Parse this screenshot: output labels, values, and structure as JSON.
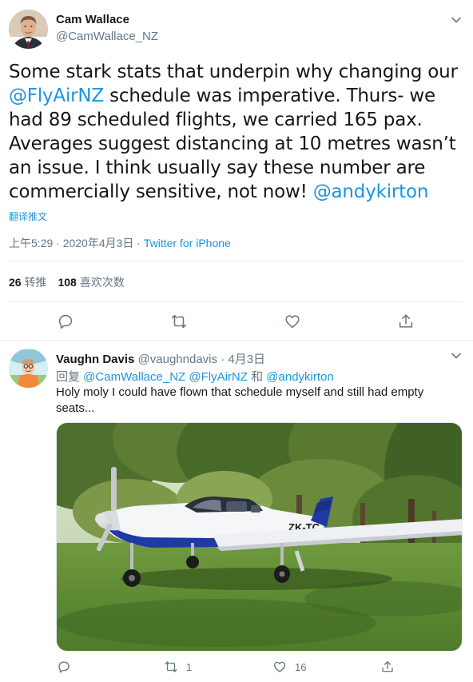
{
  "main_tweet": {
    "author_name": "Cam Wallace",
    "author_handle": "@CamWallace_NZ",
    "text_parts": [
      "Some stark stats that underpin why changing our ",
      "@FlyAirNZ",
      " schedule was imperative. Thurs- we had 89 scheduled flights, we carried 165 pax. Averages suggest distancing at 10 metres wasn’t an issue. I think usually say these number are commercially sensitive, not now! ",
      "@andykirton"
    ],
    "translate_label": "翻译推文",
    "timestamp": "上午5:29 · 2020年4月3日",
    "meta_separator": " · ",
    "source": "Twitter for iPhone",
    "retweets_count": "26",
    "retweets_label": "转推",
    "likes_count": "108",
    "likes_label": "喜欢次数",
    "actions": [
      "reply-icon",
      "retweet-icon",
      "like-icon",
      "share-icon"
    ]
  },
  "reply_tweet": {
    "author_name": "Vaughn Davis",
    "author_handle": "@vaughndavis",
    "date": "· 4月3日",
    "reply_prefix": "回复 ",
    "reply_mentions": [
      "@CamWallace_NZ",
      "@FlyAirNZ"
    ],
    "reply_conjunction": " 和 ",
    "reply_last_mention": "@andykirton",
    "text": "Holy moly I could have flown that schedule myself and still had empty seats...",
    "photo_registration": "ZK-TC",
    "retweet_count": "1",
    "like_count": "16"
  },
  "colors": {
    "accent": "#1b95e0",
    "secondary_text": "#657786",
    "divider": "#e6ecf0"
  }
}
